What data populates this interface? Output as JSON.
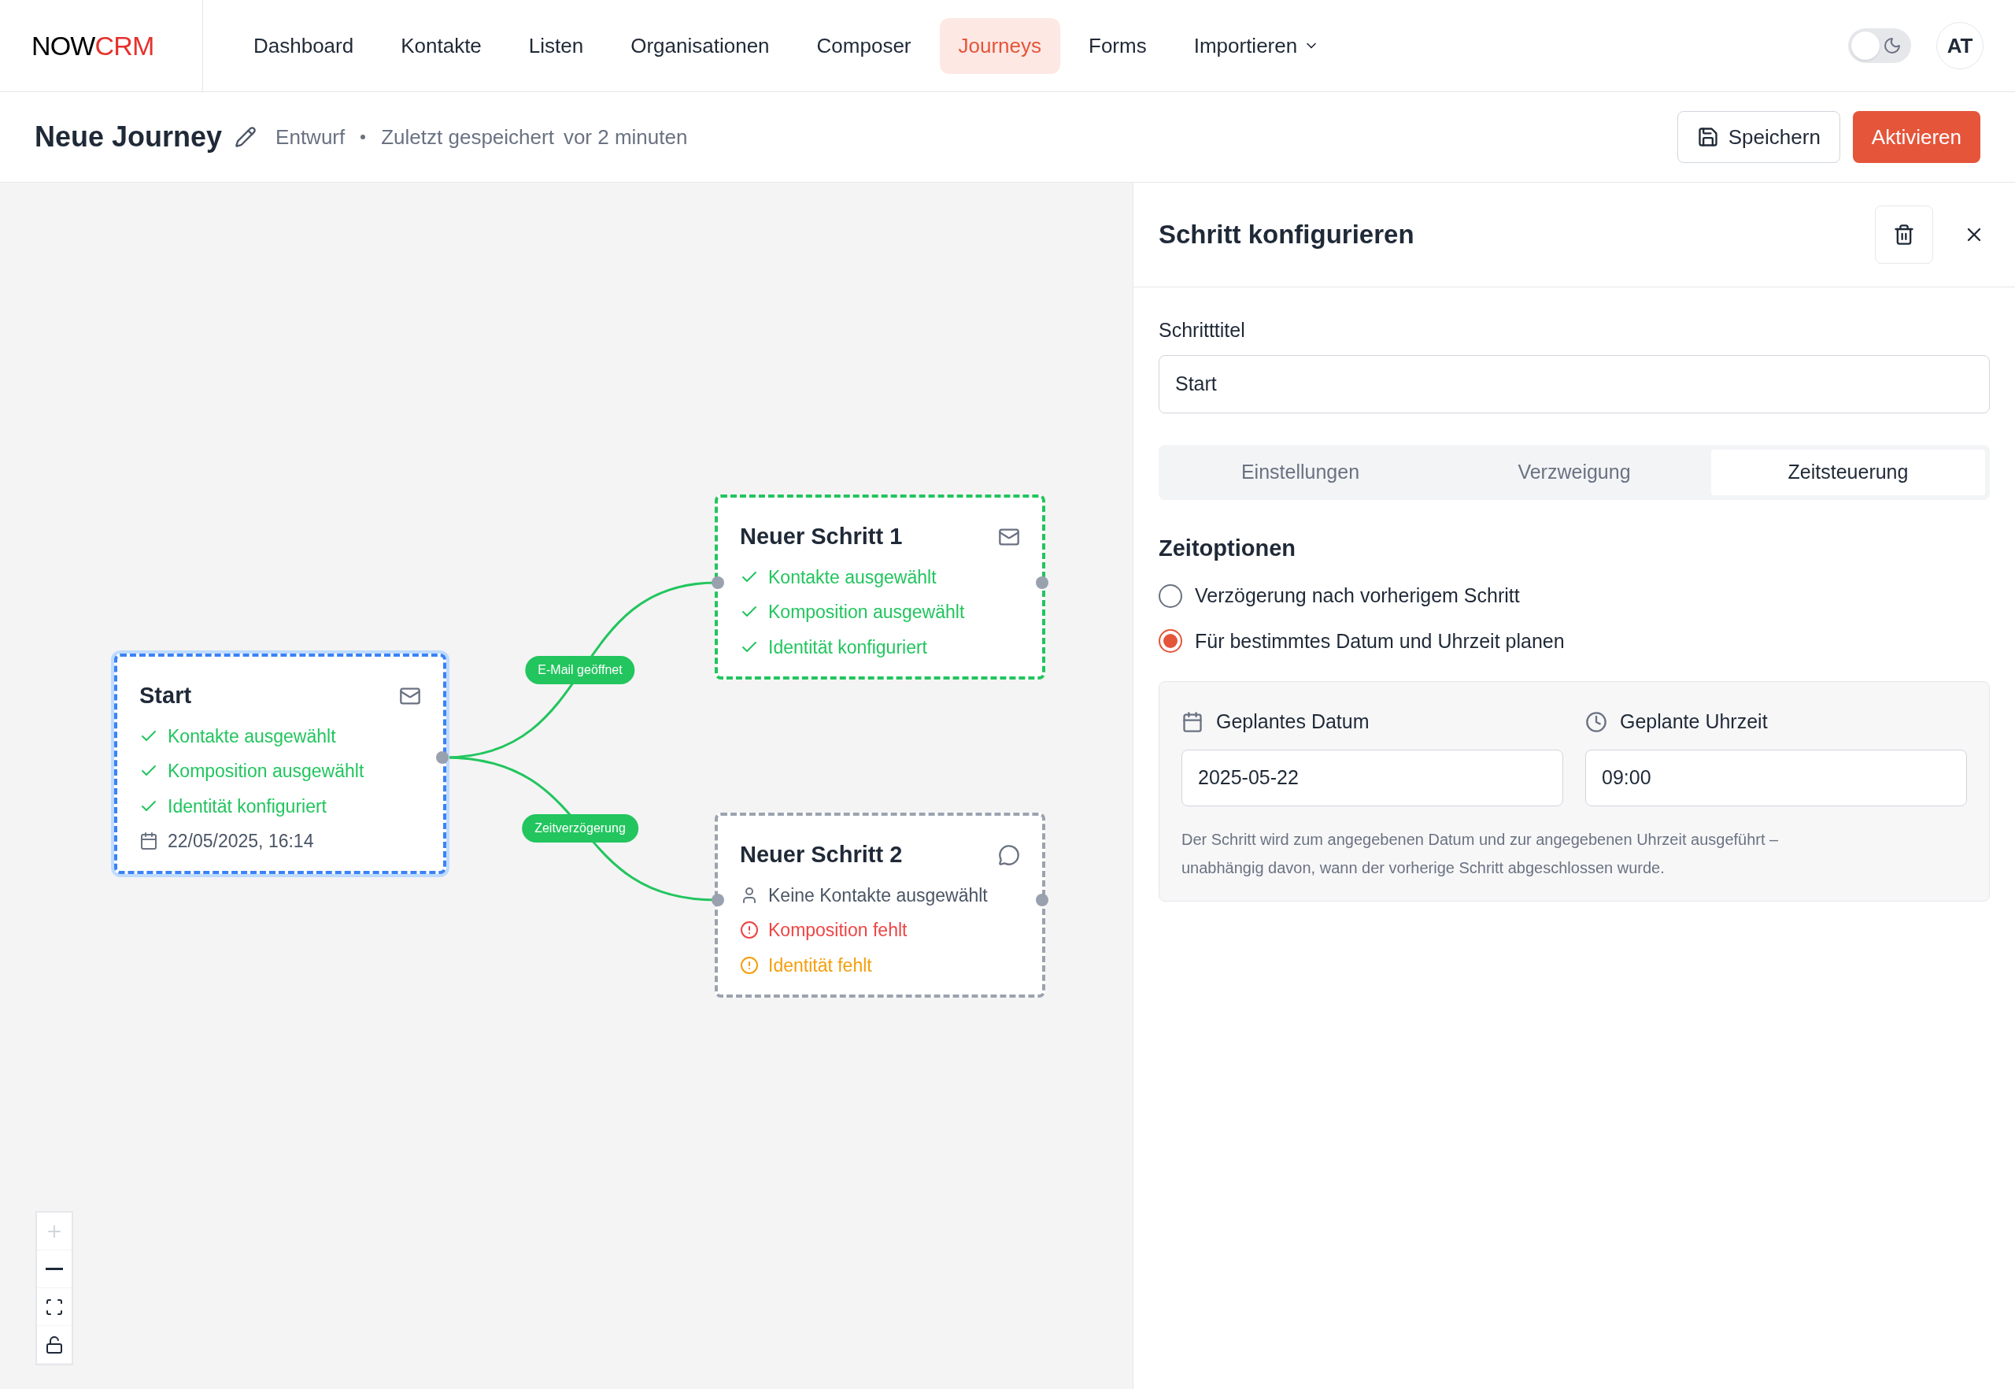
{
  "brand": {
    "first": "NOW",
    "second": "CRM"
  },
  "nav": [
    {
      "label": "Dashboard",
      "selected": false
    },
    {
      "label": "Kontakte",
      "selected": false
    },
    {
      "label": "Listen",
      "selected": false
    },
    {
      "label": "Organisationen",
      "selected": false
    },
    {
      "label": "Composer",
      "selected": false
    },
    {
      "label": "Journeys",
      "selected": true
    },
    {
      "label": "Forms",
      "selected": false
    },
    {
      "label": "Importieren",
      "selected": false,
      "dropdown": true
    }
  ],
  "theme_toggle": {
    "on": false
  },
  "avatar": "AT",
  "journey": {
    "title": "Neue Journey",
    "status": "Entwurf",
    "saved_label": "Zuletzt gespeichert",
    "saved_time": "vor 2 minuten",
    "save_button": "Speichern",
    "activate_button": "Aktivieren"
  },
  "nodes": [
    {
      "title": "Start",
      "selected": true,
      "color": "#3b82f6",
      "items": [
        {
          "kind": "ok",
          "text": "Kontakte ausgewählt"
        },
        {
          "kind": "ok",
          "text": "Komposition ausgewählt"
        },
        {
          "kind": "ok",
          "text": "Identität konfiguriert"
        },
        {
          "kind": "date",
          "text": "22/05/2025, 16:14"
        }
      ]
    },
    {
      "title": "Neuer Schritt 1",
      "selected": false,
      "color": "#22c55e",
      "items": [
        {
          "kind": "ok",
          "text": "Kontakte ausgewählt"
        },
        {
          "kind": "ok",
          "text": "Komposition ausgewählt"
        },
        {
          "kind": "ok",
          "text": "Identität konfiguriert"
        }
      ]
    },
    {
      "title": "Neuer Schritt 2",
      "selected": false,
      "color": "#9ca3af",
      "items": [
        {
          "kind": "person",
          "text": "Keine Kontakte ausgewählt"
        },
        {
          "kind": "error",
          "text": "Komposition fehlt"
        },
        {
          "kind": "warning",
          "text": "Identität fehlt"
        }
      ]
    }
  ],
  "edges": [
    {
      "label": "E-Mail geöffnet"
    },
    {
      "label": "Zeitverzögerung"
    }
  ],
  "canvas_controls": [
    {
      "kind": "zoom-in",
      "disabled": true
    },
    {
      "kind": "zoom-out",
      "disabled": false
    },
    {
      "kind": "fit",
      "disabled": false
    },
    {
      "kind": "lock",
      "disabled": false
    }
  ],
  "panel": {
    "title": "Schritt konfigurieren",
    "field_label": "Schritttitel",
    "field_value": "Start",
    "tabs": [
      {
        "label": "Einstellungen",
        "selected": false
      },
      {
        "label": "Verzweigung",
        "selected": false
      },
      {
        "label": "Zeitsteuerung",
        "selected": true
      }
    ],
    "section_title": "Zeitoptionen",
    "options": [
      {
        "label": "Verzögerung nach vorherigem Schritt",
        "selected": false
      },
      {
        "label": "Für bestimmtes Datum und Uhrzeit planen",
        "selected": true
      }
    ],
    "date_label": "Geplantes Datum",
    "date_value": "2025-05-22",
    "time_label": "Geplante Uhrzeit",
    "time_value": "09:00",
    "hint": "Der Schritt wird zum angegebenen Datum und zur angegebenen Uhrzeit ausgeführt – unabhängig davon, wann der vorherige Schritt abgeschlossen wurde."
  }
}
